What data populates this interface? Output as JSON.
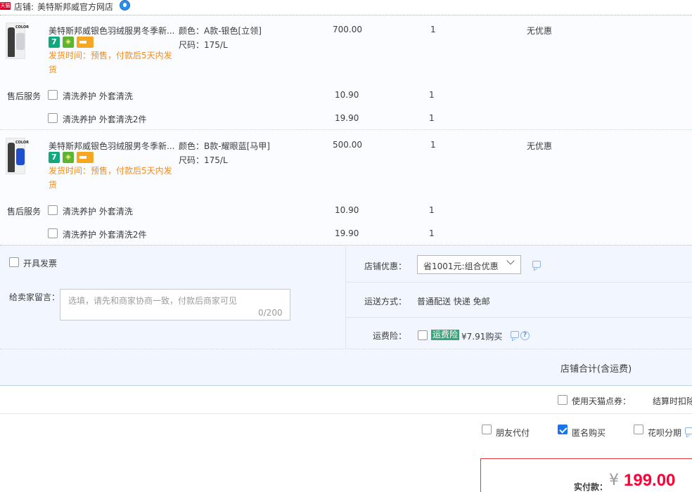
{
  "shop": {
    "badge": "天猫",
    "label": "店铺:",
    "name": "美特斯邦威官方网店"
  },
  "items": [
    {
      "title": "美特斯邦威银色羽绒服男冬季新...",
      "thumb_text": "COLOR",
      "thumb_color": "#cfd3d8",
      "badge_7": "7",
      "ship_time": "发货时间：预售，付款后5天内发货",
      "sku_color": "颜色：A款-银色[立领]",
      "sku_size": "尺码：175/L",
      "price": "700.00",
      "qty": "1",
      "discount": "无优惠",
      "service_label": "售后服务",
      "services": [
        {
          "name": "清洗养护 外套清洗",
          "price": "10.90",
          "qty": "1"
        },
        {
          "name": "清洗养护 外套清洗2件",
          "price": "19.90",
          "qty": "1"
        }
      ]
    },
    {
      "title": "美特斯邦威银色羽绒服男冬季新...",
      "thumb_text": "COLOR",
      "thumb_color": "#1f4fcf",
      "badge_7": "7",
      "ship_time": "发货时间：预售，付款后5天内发货",
      "sku_color": "颜色：B款-耀眼蓝[马甲]",
      "sku_size": "尺码：175/L",
      "price": "500.00",
      "qty": "1",
      "discount": "无优惠",
      "service_label": "售后服务",
      "services": [
        {
          "name": "清洗养护 外套清洗",
          "price": "10.90",
          "qty": "1"
        },
        {
          "name": "清洗养护 外套清洗2件",
          "price": "19.90",
          "qty": "1"
        }
      ]
    }
  ],
  "invoice": {
    "label": "开具发票"
  },
  "message": {
    "label": "给卖家留言：",
    "placeholder": "选填，请先和商家协商一致，付款后商家可见",
    "count": "0/200"
  },
  "shop_discount": {
    "label": "店铺优惠：",
    "selected": "省1001元:组合优惠"
  },
  "delivery": {
    "label": "运送方式：",
    "value": "普通配送 快递 免邮"
  },
  "insurance": {
    "label": "运费险：",
    "tag": "运费险",
    "price": "¥7.91购买"
  },
  "total": {
    "label": "店铺合计(含运费)"
  },
  "coupon": {
    "label": "使用天猫点券：",
    "note": "结算时扣除"
  },
  "payment_options": [
    {
      "label": "朋友代付",
      "checked": false
    },
    {
      "label": "匿名购买",
      "checked": true
    },
    {
      "label": "花呗分期",
      "checked": false
    }
  ],
  "pay": {
    "label": "实付款：",
    "currency": "¥",
    "amount": "199.00"
  },
  "colors": {
    "accent": "#1a73e8",
    "price_red": "#ff0036",
    "ship_orange": "#f28c1c",
    "insurance_green": "#3aa57a"
  }
}
